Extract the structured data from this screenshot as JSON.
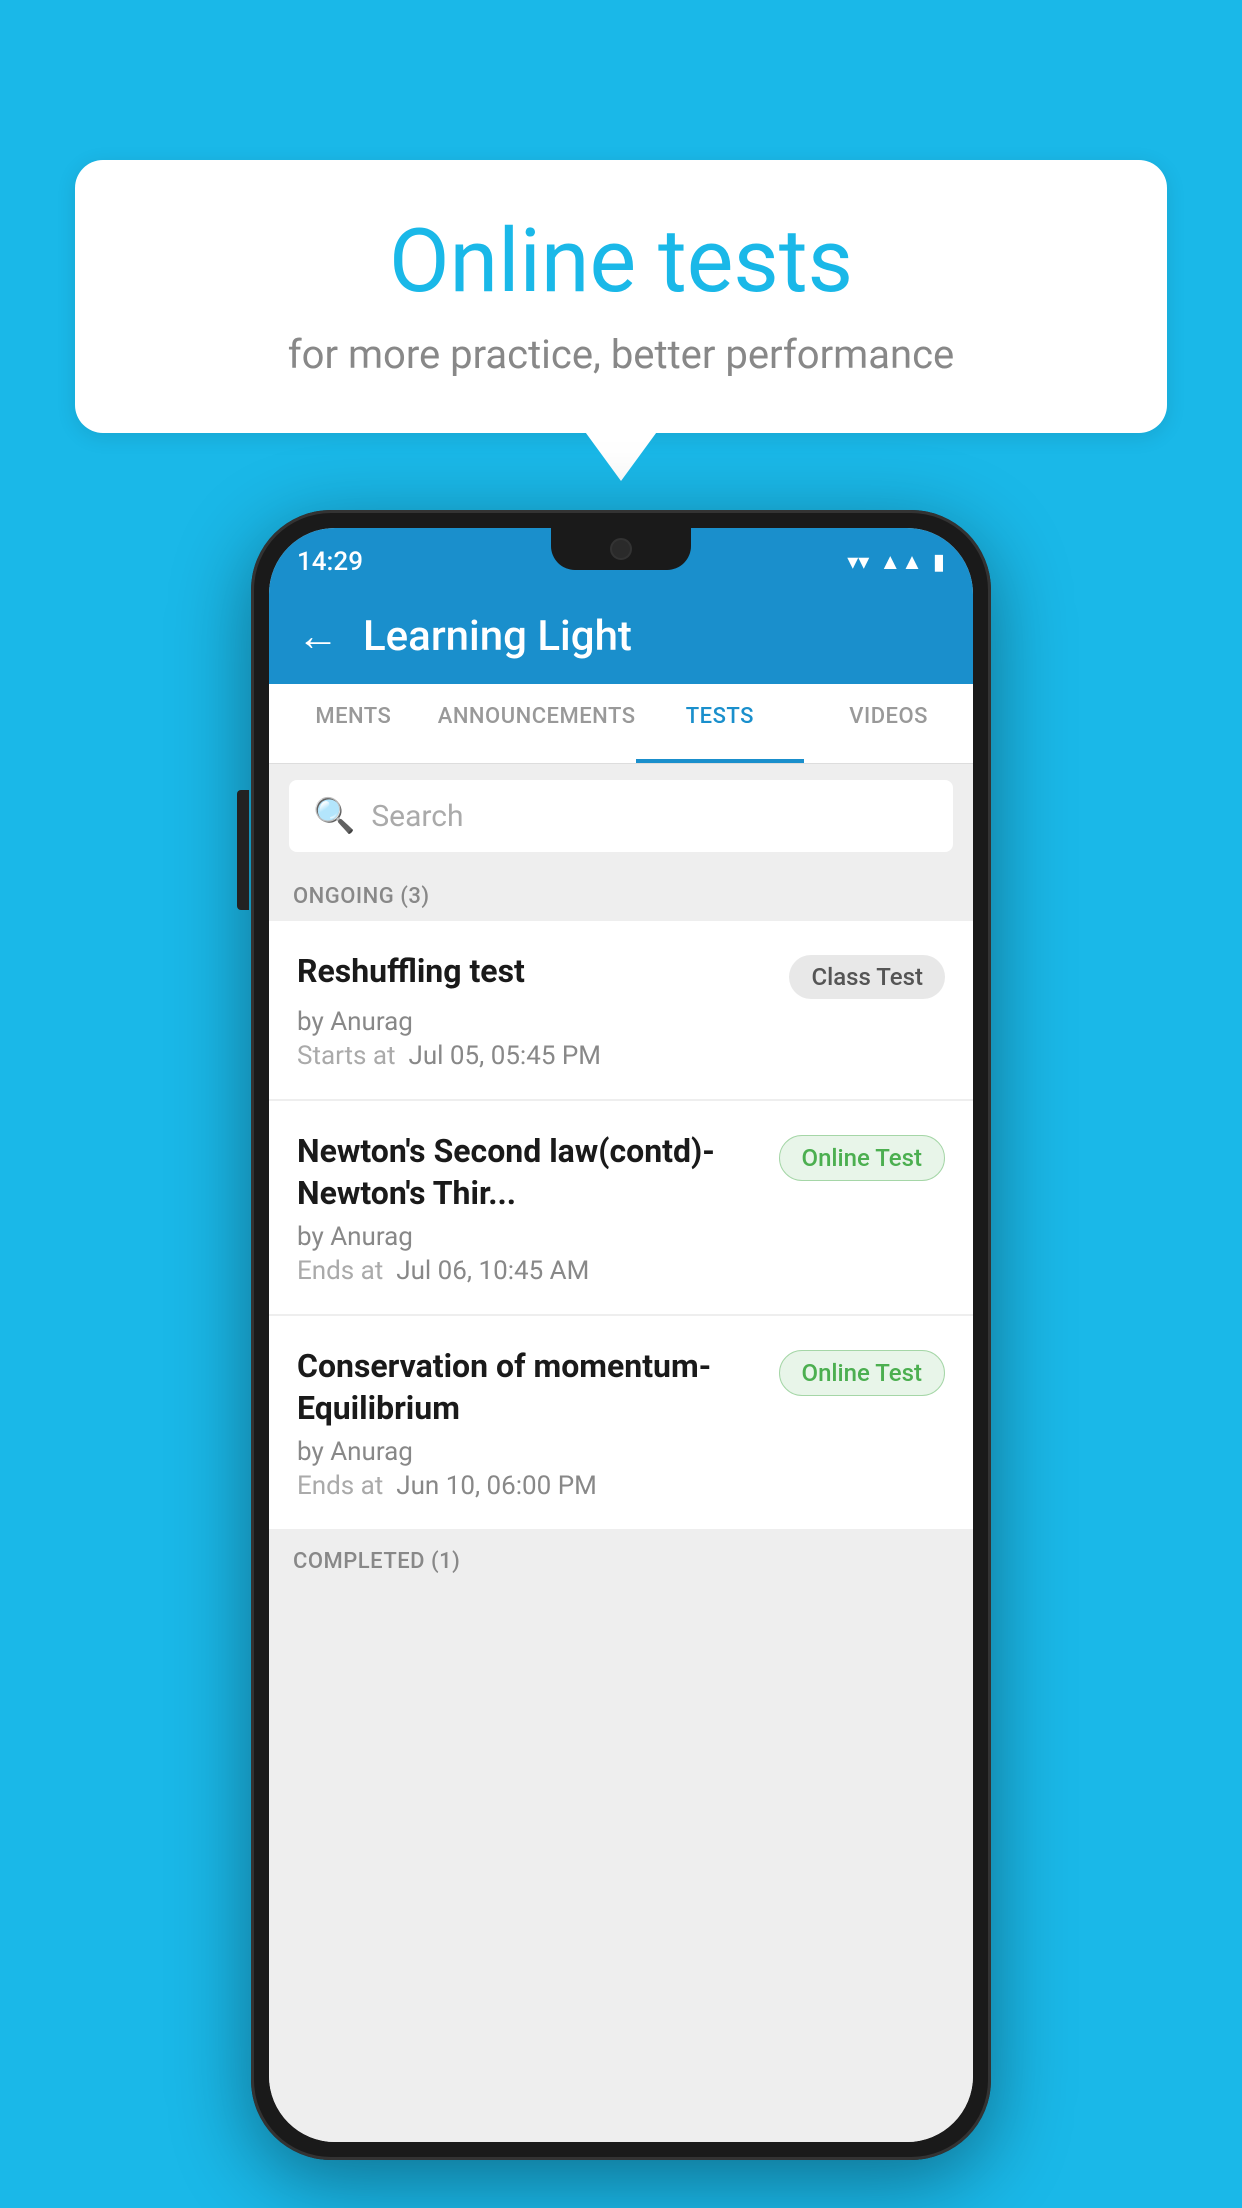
{
  "background_color": "#1ab8e8",
  "speech_bubble": {
    "title": "Online tests",
    "subtitle": "for more practice, better performance"
  },
  "phone": {
    "status_bar": {
      "time": "14:29",
      "wifi_icon": "▼",
      "signal_icon": "▲",
      "battery_icon": "▮"
    },
    "app_bar": {
      "back_label": "←",
      "title": "Learning Light"
    },
    "tabs": [
      {
        "label": "MENTS",
        "active": false
      },
      {
        "label": "ANNOUNCEMENTS",
        "active": false
      },
      {
        "label": "TESTS",
        "active": true
      },
      {
        "label": "VIDEOS",
        "active": false
      }
    ],
    "search": {
      "placeholder": "Search"
    },
    "ongoing_section": {
      "label": "ONGOING (3)"
    },
    "tests": [
      {
        "title": "Reshuffling test",
        "badge": "Class Test",
        "badge_type": "class",
        "by": "by Anurag",
        "time_label": "Starts at",
        "time_value": "Jul 05, 05:45 PM"
      },
      {
        "title": "Newton's Second law(contd)-Newton's Thir...",
        "badge": "Online Test",
        "badge_type": "online",
        "by": "by Anurag",
        "time_label": "Ends at",
        "time_value": "Jul 06, 10:45 AM"
      },
      {
        "title": "Conservation of momentum-Equilibrium",
        "badge": "Online Test",
        "badge_type": "online",
        "by": "by Anurag",
        "time_label": "Ends at",
        "time_value": "Jun 10, 06:00 PM"
      }
    ],
    "completed_section": {
      "label": "COMPLETED (1)"
    }
  }
}
